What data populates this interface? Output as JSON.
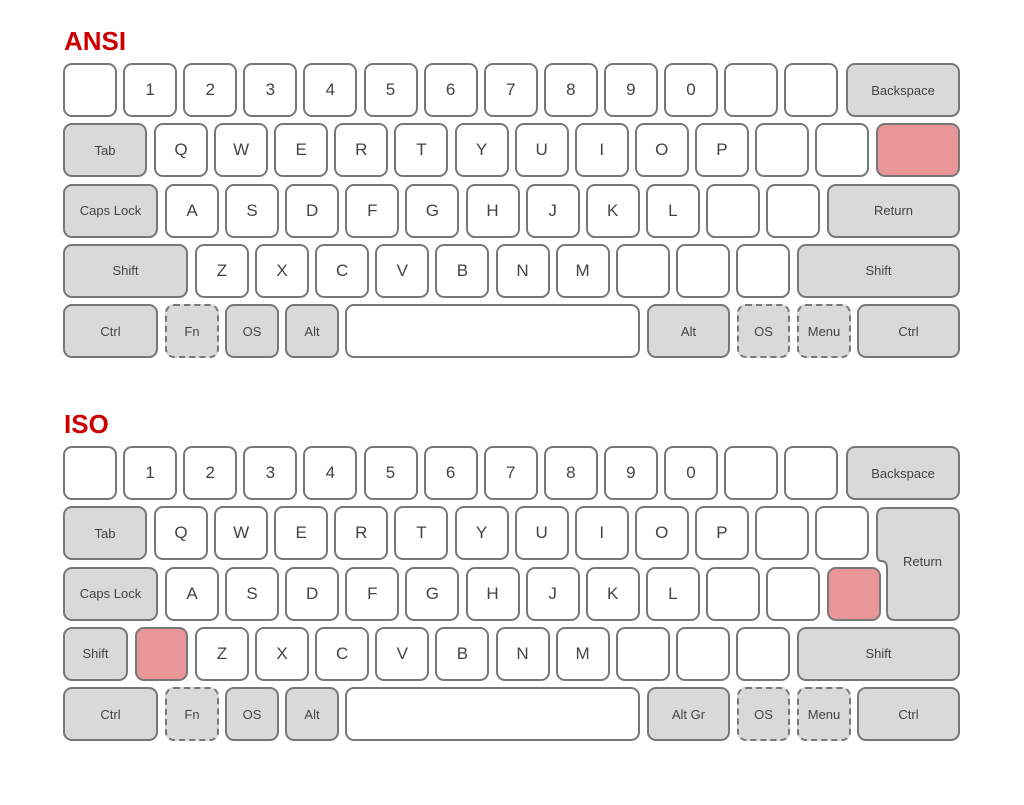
{
  "colors": {
    "title": "#cc0000",
    "key_fill": "#ffffff",
    "modifier_fill": "#d9d9d9",
    "highlight_fill": "#e99698",
    "border": "#777777",
    "label": "#444444"
  },
  "layouts": [
    {
      "id": "ansi",
      "title": "ANSI",
      "rows": [
        [
          {
            "label": "",
            "type": "normal"
          },
          {
            "label": "1",
            "type": "normal"
          },
          {
            "label": "2",
            "type": "normal"
          },
          {
            "label": "3",
            "type": "normal"
          },
          {
            "label": "4",
            "type": "normal"
          },
          {
            "label": "5",
            "type": "normal"
          },
          {
            "label": "6",
            "type": "normal"
          },
          {
            "label": "7",
            "type": "normal"
          },
          {
            "label": "8",
            "type": "normal"
          },
          {
            "label": "9",
            "type": "normal"
          },
          {
            "label": "0",
            "type": "normal"
          },
          {
            "label": "",
            "type": "normal"
          },
          {
            "label": "",
            "type": "normal"
          },
          {
            "label": "Backspace",
            "type": "modifier"
          }
        ],
        [
          {
            "label": "Tab",
            "type": "modifier"
          },
          {
            "label": "Q",
            "type": "normal"
          },
          {
            "label": "W",
            "type": "normal"
          },
          {
            "label": "E",
            "type": "normal"
          },
          {
            "label": "R",
            "type": "normal"
          },
          {
            "label": "T",
            "type": "normal"
          },
          {
            "label": "Y",
            "type": "normal"
          },
          {
            "label": "U",
            "type": "normal"
          },
          {
            "label": "I",
            "type": "normal"
          },
          {
            "label": "O",
            "type": "normal"
          },
          {
            "label": "P",
            "type": "normal"
          },
          {
            "label": "",
            "type": "normal"
          },
          {
            "label": "",
            "type": "normal"
          },
          {
            "label": "",
            "type": "highlight"
          }
        ],
        [
          {
            "label": "Caps Lock",
            "type": "modifier"
          },
          {
            "label": "A",
            "type": "normal"
          },
          {
            "label": "S",
            "type": "normal"
          },
          {
            "label": "D",
            "type": "normal"
          },
          {
            "label": "F",
            "type": "normal"
          },
          {
            "label": "G",
            "type": "normal"
          },
          {
            "label": "H",
            "type": "normal"
          },
          {
            "label": "J",
            "type": "normal"
          },
          {
            "label": "K",
            "type": "normal"
          },
          {
            "label": "L",
            "type": "normal"
          },
          {
            "label": "",
            "type": "normal"
          },
          {
            "label": "",
            "type": "normal"
          },
          {
            "label": "Return",
            "type": "modifier"
          }
        ],
        [
          {
            "label": "Shift",
            "type": "modifier"
          },
          {
            "label": "Z",
            "type": "normal"
          },
          {
            "label": "X",
            "type": "normal"
          },
          {
            "label": "C",
            "type": "normal"
          },
          {
            "label": "V",
            "type": "normal"
          },
          {
            "label": "B",
            "type": "normal"
          },
          {
            "label": "N",
            "type": "normal"
          },
          {
            "label": "M",
            "type": "normal"
          },
          {
            "label": "",
            "type": "normal"
          },
          {
            "label": "",
            "type": "normal"
          },
          {
            "label": "",
            "type": "normal"
          },
          {
            "label": "Shift",
            "type": "modifier"
          }
        ],
        [
          {
            "label": "Ctrl",
            "type": "modifier"
          },
          {
            "label": "Fn",
            "type": "optional"
          },
          {
            "label": "OS",
            "type": "modifier"
          },
          {
            "label": "Alt",
            "type": "modifier"
          },
          {
            "label": "",
            "type": "normal"
          },
          {
            "label": "Alt",
            "type": "modifier"
          },
          {
            "label": "OS",
            "type": "optional"
          },
          {
            "label": "Menu",
            "type": "optional"
          },
          {
            "label": "Ctrl",
            "type": "modifier"
          }
        ]
      ]
    },
    {
      "id": "iso",
      "title": "ISO",
      "rows": [
        [
          {
            "label": "",
            "type": "normal"
          },
          {
            "label": "1",
            "type": "normal"
          },
          {
            "label": "2",
            "type": "normal"
          },
          {
            "label": "3",
            "type": "normal"
          },
          {
            "label": "4",
            "type": "normal"
          },
          {
            "label": "5",
            "type": "normal"
          },
          {
            "label": "6",
            "type": "normal"
          },
          {
            "label": "7",
            "type": "normal"
          },
          {
            "label": "8",
            "type": "normal"
          },
          {
            "label": "9",
            "type": "normal"
          },
          {
            "label": "0",
            "type": "normal"
          },
          {
            "label": "",
            "type": "normal"
          },
          {
            "label": "",
            "type": "normal"
          },
          {
            "label": "Backspace",
            "type": "modifier"
          }
        ],
        [
          {
            "label": "Tab",
            "type": "modifier"
          },
          {
            "label": "Q",
            "type": "normal"
          },
          {
            "label": "W",
            "type": "normal"
          },
          {
            "label": "E",
            "type": "normal"
          },
          {
            "label": "R",
            "type": "normal"
          },
          {
            "label": "T",
            "type": "normal"
          },
          {
            "label": "Y",
            "type": "normal"
          },
          {
            "label": "U",
            "type": "normal"
          },
          {
            "label": "I",
            "type": "normal"
          },
          {
            "label": "O",
            "type": "normal"
          },
          {
            "label": "P",
            "type": "normal"
          },
          {
            "label": "",
            "type": "normal"
          },
          {
            "label": "",
            "type": "normal"
          }
        ],
        [
          {
            "label": "Caps Lock",
            "type": "modifier"
          },
          {
            "label": "A",
            "type": "normal"
          },
          {
            "label": "S",
            "type": "normal"
          },
          {
            "label": "D",
            "type": "normal"
          },
          {
            "label": "F",
            "type": "normal"
          },
          {
            "label": "G",
            "type": "normal"
          },
          {
            "label": "H",
            "type": "normal"
          },
          {
            "label": "J",
            "type": "normal"
          },
          {
            "label": "K",
            "type": "normal"
          },
          {
            "label": "L",
            "type": "normal"
          },
          {
            "label": "",
            "type": "normal"
          },
          {
            "label": "",
            "type": "normal"
          },
          {
            "label": "",
            "type": "highlight"
          }
        ],
        [
          {
            "label": "Shift",
            "type": "modifier"
          },
          {
            "label": "",
            "type": "highlight"
          },
          {
            "label": "Z",
            "type": "normal"
          },
          {
            "label": "X",
            "type": "normal"
          },
          {
            "label": "C",
            "type": "normal"
          },
          {
            "label": "V",
            "type": "normal"
          },
          {
            "label": "B",
            "type": "normal"
          },
          {
            "label": "N",
            "type": "normal"
          },
          {
            "label": "M",
            "type": "normal"
          },
          {
            "label": "",
            "type": "normal"
          },
          {
            "label": "",
            "type": "normal"
          },
          {
            "label": "",
            "type": "normal"
          },
          {
            "label": "Shift",
            "type": "modifier"
          }
        ],
        [
          {
            "label": "Ctrl",
            "type": "modifier"
          },
          {
            "label": "Fn",
            "type": "optional"
          },
          {
            "label": "OS",
            "type": "modifier"
          },
          {
            "label": "Alt",
            "type": "modifier"
          },
          {
            "label": "",
            "type": "normal"
          },
          {
            "label": "Alt Gr",
            "type": "modifier"
          },
          {
            "label": "OS",
            "type": "optional"
          },
          {
            "label": "Menu",
            "type": "optional"
          },
          {
            "label": "Ctrl",
            "type": "modifier"
          }
        ]
      ],
      "return_key": {
        "label": "Return",
        "type": "modifier"
      }
    }
  ]
}
